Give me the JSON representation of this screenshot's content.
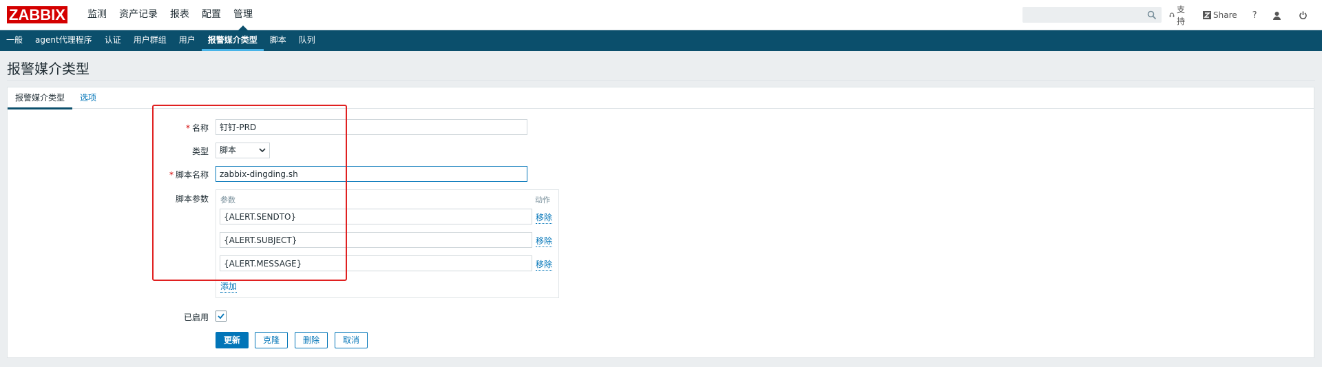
{
  "topbar": {
    "logo": "ZABBIX",
    "main_menu": [
      {
        "label": "监测",
        "active": false
      },
      {
        "label": "资产记录",
        "active": false
      },
      {
        "label": "报表",
        "active": false
      },
      {
        "label": "配置",
        "active": false
      },
      {
        "label": "管理",
        "active": true
      }
    ],
    "search": {
      "value": "",
      "placeholder": ""
    },
    "links": {
      "support": "支持",
      "share": "Share",
      "help": "?"
    }
  },
  "submenu": [
    {
      "label": "一般",
      "active": false
    },
    {
      "label": "agent代理程序",
      "active": false
    },
    {
      "label": "认证",
      "active": false
    },
    {
      "label": "用户群组",
      "active": false
    },
    {
      "label": "用户",
      "active": false
    },
    {
      "label": "报警媒介类型",
      "active": true
    },
    {
      "label": "脚本",
      "active": false
    },
    {
      "label": "队列",
      "active": false
    }
  ],
  "page": {
    "title": "报警媒介类型"
  },
  "tabs": [
    {
      "label": "报警媒介类型",
      "active": true
    },
    {
      "label": "选项",
      "active": false
    }
  ],
  "form": {
    "name_label": "名称",
    "name_value": "钉钉-PRD",
    "type_label": "类型",
    "type_value": "脚本",
    "script_name_label": "脚本名称",
    "script_name_value": "zabbix-dingding.sh",
    "script_params_label": "脚本参数",
    "params_header": "参数",
    "action_header": "动作",
    "params": [
      {
        "value": "{ALERT.SENDTO}",
        "remove": "移除"
      },
      {
        "value": "{ALERT.SUBJECT}",
        "remove": "移除"
      },
      {
        "value": "{ALERT.MESSAGE}",
        "remove": "移除"
      }
    ],
    "add_label": "添加",
    "enabled_label": "已启用",
    "enabled": true
  },
  "buttons": {
    "update": "更新",
    "clone": "克隆",
    "delete": "删除",
    "cancel": "取消"
  },
  "colors": {
    "brand": "#d40000",
    "nav": "#0b4f6c",
    "link": "#0275b8",
    "annotation": "#e02020"
  }
}
